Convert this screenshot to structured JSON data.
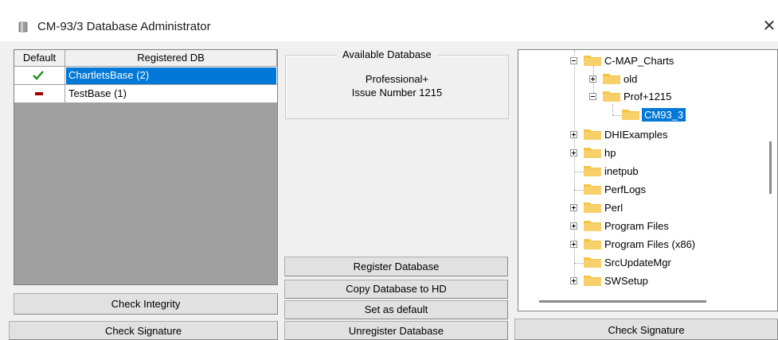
{
  "window": {
    "title": "CM-93/3 Database Administrator",
    "close_glyph": "✕"
  },
  "left_table": {
    "headers": {
      "default": "Default",
      "registered": "Registered DB"
    },
    "rows": [
      {
        "name": "ChartletsBase (2)",
        "default_icon": "check-icon",
        "selected": true
      },
      {
        "name": "TestBase (1)",
        "default_icon": "dash-icon",
        "selected": false
      }
    ],
    "buttons": {
      "check_integrity": "Check Integrity",
      "check_signature": "Check Signature"
    }
  },
  "available": {
    "title": "Available Database",
    "line1": "Professional+",
    "line2": "Issue Number 1215"
  },
  "middle_buttons": {
    "register": "Register Database",
    "copy": "Copy Database to HD",
    "set_default": "Set as default",
    "unregister": "Unregister Database"
  },
  "tree": {
    "items": [
      {
        "label": "C-MAP_Charts"
      },
      {
        "label": "old"
      },
      {
        "label": "Prof+1215"
      },
      {
        "label": "CM93_3"
      },
      {
        "label": "DHIExamples"
      },
      {
        "label": "hp"
      },
      {
        "label": "inetpub"
      },
      {
        "label": "PerfLogs"
      },
      {
        "label": "Perl"
      },
      {
        "label": "Program Files"
      },
      {
        "label": "Program Files (x86)"
      },
      {
        "label": "SrcUpdateMgr"
      },
      {
        "label": "SWSetup"
      }
    ],
    "check_signature": "Check Signature"
  },
  "colors": {
    "selection": "#0078d7",
    "check": "#1a8a1a",
    "dash": "#a30000",
    "folder": "#f5c342"
  }
}
